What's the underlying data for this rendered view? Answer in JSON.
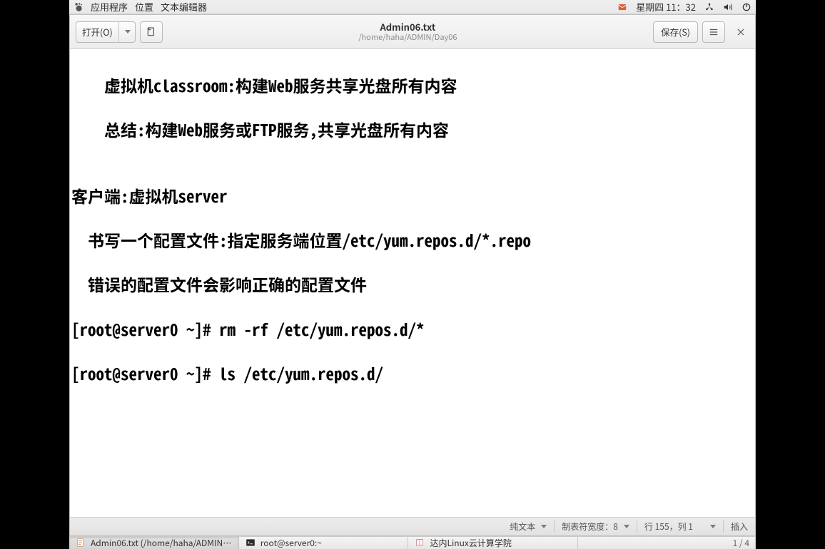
{
  "menubar": {
    "items": [
      "应用程序",
      "位置",
      "文本编辑器"
    ],
    "datetime": "星期四 11：32"
  },
  "toolbar": {
    "open_label": "打开(O)",
    "save_label": "保存(S)"
  },
  "document": {
    "title": "Admin06.txt",
    "path": "/home/haha/ADMIN/Day06"
  },
  "content": {
    "lines": [
      "    虚拟机classroom:构建Web服务共享光盘所有内容",
      "    总结:构建Web服务或FTP服务,共享光盘所有内容",
      "",
      "客户端:虚拟机server",
      "  书写一个配置文件:指定服务端位置/etc/yum.repos.d/*.repo",
      "  错误的配置文件会影响正确的配置文件",
      "[root@server0 ~]# rm -rf /etc/yum.repos.d/*",
      "[root@server0 ~]# ls /etc/yum.repos.d/",
      "",
      ""
    ]
  },
  "statusbar": {
    "syntax": "纯文本",
    "tabwidth": "制表符宽度：8",
    "position": "行 155，列 1",
    "page": "1 / 4",
    "insert": "插入"
  },
  "taskbar": {
    "items": [
      {
        "label": "Admin06.txt (/home/haha/ADMIN/…",
        "icon": "editor"
      },
      {
        "label": "root@server0:~",
        "icon": "terminal"
      },
      {
        "label": "达内Linux云计算学院",
        "icon": "book"
      }
    ]
  }
}
